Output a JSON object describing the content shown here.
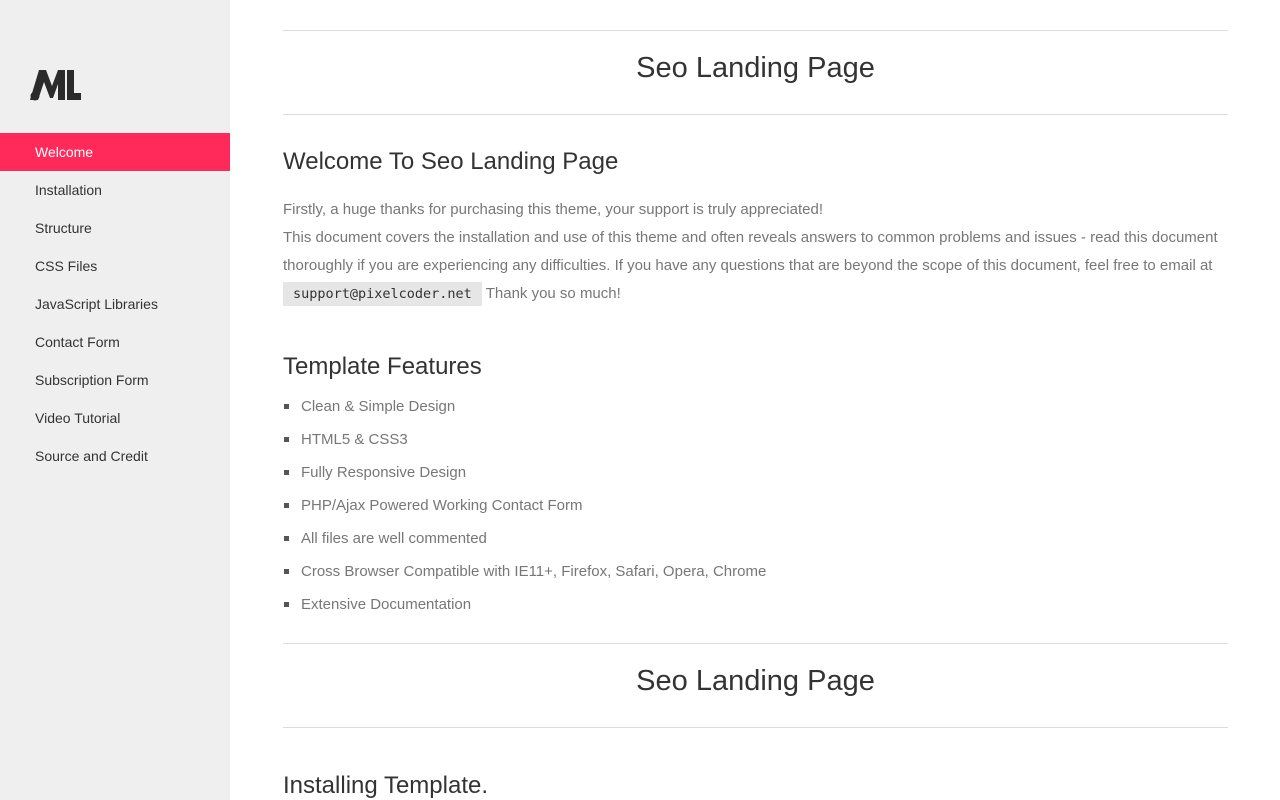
{
  "sidebar": {
    "logo": "M.",
    "items": [
      {
        "label": "Welcome",
        "active": true
      },
      {
        "label": "Installation"
      },
      {
        "label": "Structure"
      },
      {
        "label": "CSS Files"
      },
      {
        "label": "JavaScript Libraries"
      },
      {
        "label": "Contact Form"
      },
      {
        "label": "Subscription Form"
      },
      {
        "label": "Video Tutorial"
      },
      {
        "label": "Source and Credit"
      }
    ]
  },
  "main": {
    "section1": {
      "page_title": "Seo Landing Page",
      "heading": "Welcome To Seo Landing Page",
      "intro_line1": "Firstly, a huge thanks for purchasing this theme, your support is truly appreciated!",
      "intro_line2": "This document covers the installation and use of this theme and often reveals answers to common problems and issues - read this document thoroughly if you are experiencing any difficulties. If you have any questions that are beyond the scope of this document, feel free to email at",
      "email": "support@pixelcoder.net",
      "intro_tail": "Thank you so much!"
    },
    "features": {
      "heading": "Template Features",
      "items": [
        "Clean & Simple Design",
        "HTML5 & CSS3",
        "Fully Responsive Design",
        "PHP/Ajax Powered Working Contact Form",
        "All files are well commented",
        "Cross Browser Compatible with IE11+, Firefox, Safari, Opera, Chrome",
        "Extensive Documentation"
      ]
    },
    "section2": {
      "page_title": "Seo Landing Page",
      "heading": "Installing Template."
    }
  },
  "colors": {
    "accent": "#ff2a5a",
    "sidebar_bg": "#efefef",
    "body_text": "#777777",
    "heading_text": "#333333"
  }
}
